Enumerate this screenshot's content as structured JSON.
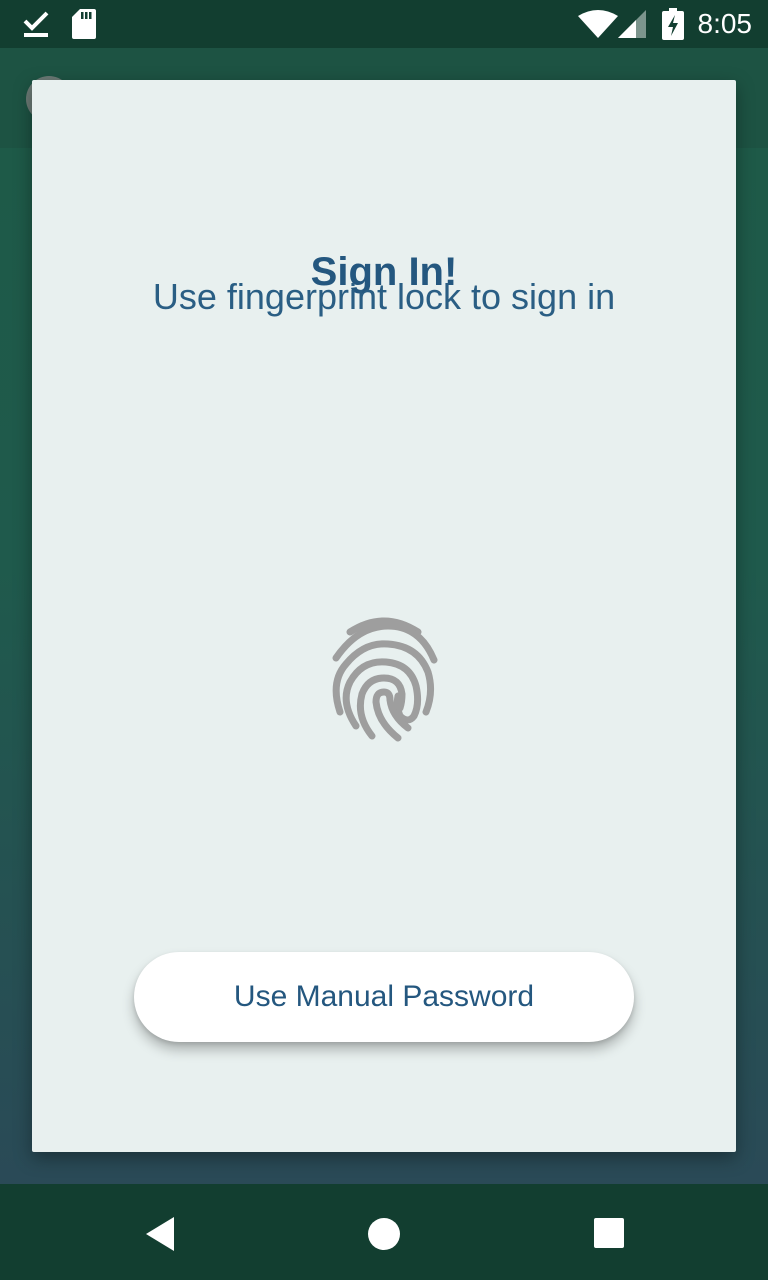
{
  "status_bar": {
    "time": "8:05",
    "icons": [
      "download-done-icon",
      "sd-card-icon",
      "wifi-icon",
      "cell-signal-icon",
      "battery-charging-icon"
    ]
  },
  "dialog": {
    "title": "Sign In!",
    "subtitle": "Use fingerprint lock to sign in",
    "fingerprint_icon": "fingerprint-icon",
    "manual_password_button": "Use Manual Password"
  },
  "nav_bar": {
    "icons": [
      "back-icon",
      "home-icon",
      "recents-icon"
    ]
  },
  "colors": {
    "status_bar": "#123e30",
    "dialog_bg": "#e8f0ef",
    "title_text": "#24577f",
    "fingerprint": "#9e9e9e",
    "button_bg": "#ffffff"
  }
}
